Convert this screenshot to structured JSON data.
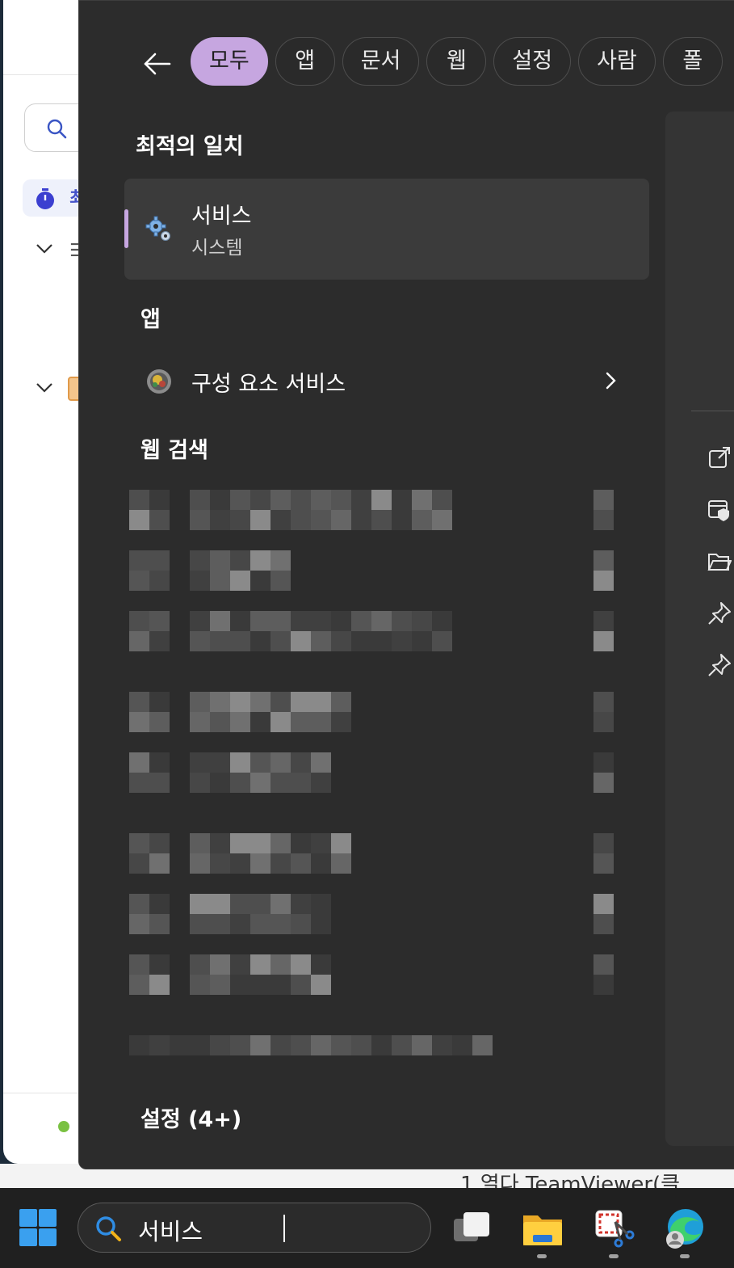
{
  "search_panel": {
    "filters": [
      {
        "label": "모두",
        "active": true
      },
      {
        "label": "앱",
        "active": false
      },
      {
        "label": "문서",
        "active": false
      },
      {
        "label": "웹",
        "active": false
      },
      {
        "label": "설정",
        "active": false
      },
      {
        "label": "사람",
        "active": false
      },
      {
        "label": "폴",
        "active": false
      }
    ],
    "best_match": {
      "section_title": "최적의 일치",
      "title": "서비스",
      "subtitle": "시스템",
      "icon": "services-gear-icon"
    },
    "apps": {
      "section_title": "앱",
      "items": [
        {
          "label": "구성 요소 서비스",
          "icon": "component-services-icon"
        }
      ]
    },
    "web_search": {
      "section_title": "웹 검색"
    },
    "settings": {
      "section_title": "설정 (4+)"
    },
    "accent_color": "#c6a6e0"
  },
  "detail_actions": [
    "open-external-icon",
    "run-as-admin-icon",
    "open-folder-icon",
    "pin-start-icon",
    "pin-taskbar-icon"
  ],
  "taskbar": {
    "search_value": "서비스",
    "apps": [
      "task-view-icon",
      "file-explorer-icon",
      "snipping-tool-icon",
      "edge-profile-icon"
    ]
  },
  "background_window": {
    "label_fragment": "최",
    "strip_text": "1    열다 TeamViewer(클"
  }
}
